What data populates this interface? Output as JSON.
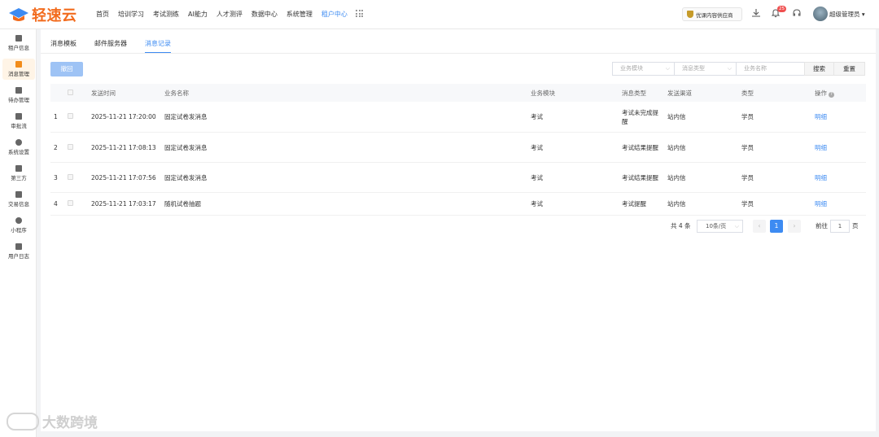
{
  "header": {
    "logo_text": "轻速云",
    "nav": [
      "首页",
      "培训学习",
      "考试测练",
      "AI能力",
      "人才测评",
      "数据中心",
      "系统管理",
      "租户中心"
    ],
    "nav_active_index": 7,
    "promo_label": "优课内容供应商",
    "notification_count": "25",
    "user_name": "超级管理员"
  },
  "sidebar": {
    "items": [
      {
        "label": "租户信息",
        "icon": "building-icon"
      },
      {
        "label": "消息管理",
        "icon": "envelope-icon"
      },
      {
        "label": "待办管理",
        "icon": "clipboard-icon"
      },
      {
        "label": "审批流",
        "icon": "flow-icon"
      },
      {
        "label": "系统设置",
        "icon": "gear-icon"
      },
      {
        "label": "第三方",
        "icon": "plugin-icon"
      },
      {
        "label": "交易信息",
        "icon": "wallet-icon"
      },
      {
        "label": "小程序",
        "icon": "miniapp-icon"
      },
      {
        "label": "用户日志",
        "icon": "log-icon"
      }
    ],
    "active_index": 1
  },
  "tabs": [
    {
      "label": "消息模板"
    },
    {
      "label": "邮件服务器"
    },
    {
      "label": "消息记录"
    }
  ],
  "toolbar": {
    "withdraw_label": "撤回",
    "filter_module_placeholder": "业务模块",
    "filter_type_placeholder": "消息类型",
    "filter_name_placeholder": "业务名称",
    "search_label": "搜索",
    "reset_label": "重置"
  },
  "table": {
    "headers": [
      "发送时间",
      "业务名称",
      "业务模块",
      "消息类型",
      "发送渠道",
      "类型",
      "操作"
    ],
    "rows": [
      {
        "index": "1",
        "time": "2025-11-21 17:20:00",
        "name": "固定试卷发消息",
        "module": "考试",
        "msg_type": "考试未完成提醒",
        "channel": "站内信",
        "kind": "学员",
        "action": "明细"
      },
      {
        "index": "2",
        "time": "2025-11-21 17:08:13",
        "name": "固定试卷发消息",
        "module": "考试",
        "msg_type": "考试结果提醒",
        "channel": "站内信",
        "kind": "学员",
        "action": "明细"
      },
      {
        "index": "3",
        "time": "2025-11-21 17:07:56",
        "name": "固定试卷发消息",
        "module": "考试",
        "msg_type": "考试结果提醒",
        "channel": "站内信",
        "kind": "学员",
        "action": "明细"
      },
      {
        "index": "4",
        "time": "2025-11-21 17:03:17",
        "name": "随机试卷抽题",
        "module": "考试",
        "msg_type": "考试提醒",
        "channel": "站内信",
        "kind": "学员",
        "action": "明细"
      }
    ]
  },
  "pagination": {
    "total": "共 4 条",
    "page_size": "10条/页",
    "current_page": "1",
    "goto_label": "前往",
    "goto_value": "1",
    "page_unit": "页"
  },
  "watermark": "大数跨境",
  "colors": {
    "accent": "#3d8bf2",
    "brand": "#f26b1d"
  }
}
